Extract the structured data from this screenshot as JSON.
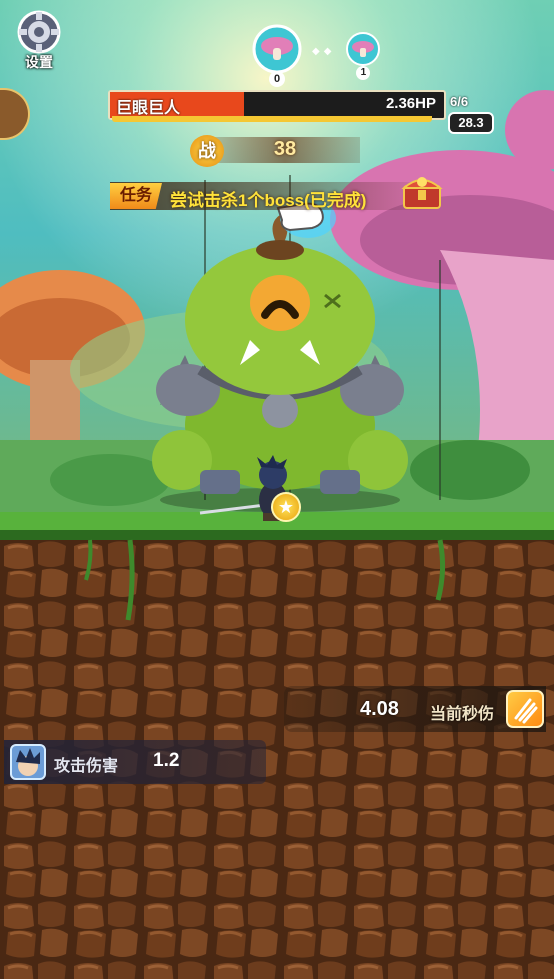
{
  "top_bar": {
    "settings_label": "设置",
    "stages": [
      {
        "number": "0",
        "state": "current"
      },
      {
        "number": "1",
        "state": "next"
      }
    ]
  },
  "boss": {
    "name": "巨眼巨人",
    "hp_text": "2.36HP",
    "hp_fraction": 0.4,
    "wave": "6/6",
    "timer": "28.3"
  },
  "power": {
    "label": "战",
    "value": "38"
  },
  "task": {
    "tag": "任务",
    "text": "尝试击杀1个boss(已完成)"
  },
  "stats": {
    "dps_value": "4.08",
    "dps_label": "当前秒伤",
    "attack_label": "攻击伤害",
    "attack_value": "1.2"
  },
  "icons": {
    "settings": "gear-icon",
    "chest": "treasure-chest-icon",
    "dps": "claw-slash-icon",
    "attack": "hero-portrait-icon",
    "pointer": "hand-pointer-icon",
    "coin": "star-coin-icon"
  },
  "colors": {
    "hp_fill": "#e8481c",
    "task_text": "#ffe23a",
    "accent_gold": "#f5c733"
  }
}
